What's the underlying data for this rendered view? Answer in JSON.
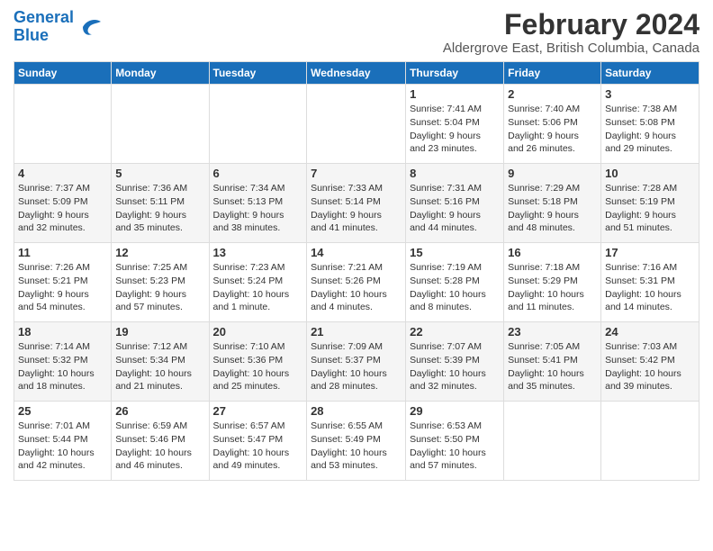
{
  "header": {
    "title": "February 2024",
    "location": "Aldergrove East, British Columbia, Canada",
    "logo_line1": "General",
    "logo_line2": "Blue"
  },
  "days_of_week": [
    "Sunday",
    "Monday",
    "Tuesday",
    "Wednesday",
    "Thursday",
    "Friday",
    "Saturday"
  ],
  "weeks": [
    [
      {
        "day": "",
        "info": ""
      },
      {
        "day": "",
        "info": ""
      },
      {
        "day": "",
        "info": ""
      },
      {
        "day": "",
        "info": ""
      },
      {
        "day": "1",
        "info": "Sunrise: 7:41 AM\nSunset: 5:04 PM\nDaylight: 9 hours\nand 23 minutes."
      },
      {
        "day": "2",
        "info": "Sunrise: 7:40 AM\nSunset: 5:06 PM\nDaylight: 9 hours\nand 26 minutes."
      },
      {
        "day": "3",
        "info": "Sunrise: 7:38 AM\nSunset: 5:08 PM\nDaylight: 9 hours\nand 29 minutes."
      }
    ],
    [
      {
        "day": "4",
        "info": "Sunrise: 7:37 AM\nSunset: 5:09 PM\nDaylight: 9 hours\nand 32 minutes."
      },
      {
        "day": "5",
        "info": "Sunrise: 7:36 AM\nSunset: 5:11 PM\nDaylight: 9 hours\nand 35 minutes."
      },
      {
        "day": "6",
        "info": "Sunrise: 7:34 AM\nSunset: 5:13 PM\nDaylight: 9 hours\nand 38 minutes."
      },
      {
        "day": "7",
        "info": "Sunrise: 7:33 AM\nSunset: 5:14 PM\nDaylight: 9 hours\nand 41 minutes."
      },
      {
        "day": "8",
        "info": "Sunrise: 7:31 AM\nSunset: 5:16 PM\nDaylight: 9 hours\nand 44 minutes."
      },
      {
        "day": "9",
        "info": "Sunrise: 7:29 AM\nSunset: 5:18 PM\nDaylight: 9 hours\nand 48 minutes."
      },
      {
        "day": "10",
        "info": "Sunrise: 7:28 AM\nSunset: 5:19 PM\nDaylight: 9 hours\nand 51 minutes."
      }
    ],
    [
      {
        "day": "11",
        "info": "Sunrise: 7:26 AM\nSunset: 5:21 PM\nDaylight: 9 hours\nand 54 minutes."
      },
      {
        "day": "12",
        "info": "Sunrise: 7:25 AM\nSunset: 5:23 PM\nDaylight: 9 hours\nand 57 minutes."
      },
      {
        "day": "13",
        "info": "Sunrise: 7:23 AM\nSunset: 5:24 PM\nDaylight: 10 hours\nand 1 minute."
      },
      {
        "day": "14",
        "info": "Sunrise: 7:21 AM\nSunset: 5:26 PM\nDaylight: 10 hours\nand 4 minutes."
      },
      {
        "day": "15",
        "info": "Sunrise: 7:19 AM\nSunset: 5:28 PM\nDaylight: 10 hours\nand 8 minutes."
      },
      {
        "day": "16",
        "info": "Sunrise: 7:18 AM\nSunset: 5:29 PM\nDaylight: 10 hours\nand 11 minutes."
      },
      {
        "day": "17",
        "info": "Sunrise: 7:16 AM\nSunset: 5:31 PM\nDaylight: 10 hours\nand 14 minutes."
      }
    ],
    [
      {
        "day": "18",
        "info": "Sunrise: 7:14 AM\nSunset: 5:32 PM\nDaylight: 10 hours\nand 18 minutes."
      },
      {
        "day": "19",
        "info": "Sunrise: 7:12 AM\nSunset: 5:34 PM\nDaylight: 10 hours\nand 21 minutes."
      },
      {
        "day": "20",
        "info": "Sunrise: 7:10 AM\nSunset: 5:36 PM\nDaylight: 10 hours\nand 25 minutes."
      },
      {
        "day": "21",
        "info": "Sunrise: 7:09 AM\nSunset: 5:37 PM\nDaylight: 10 hours\nand 28 minutes."
      },
      {
        "day": "22",
        "info": "Sunrise: 7:07 AM\nSunset: 5:39 PM\nDaylight: 10 hours\nand 32 minutes."
      },
      {
        "day": "23",
        "info": "Sunrise: 7:05 AM\nSunset: 5:41 PM\nDaylight: 10 hours\nand 35 minutes."
      },
      {
        "day": "24",
        "info": "Sunrise: 7:03 AM\nSunset: 5:42 PM\nDaylight: 10 hours\nand 39 minutes."
      }
    ],
    [
      {
        "day": "25",
        "info": "Sunrise: 7:01 AM\nSunset: 5:44 PM\nDaylight: 10 hours\nand 42 minutes."
      },
      {
        "day": "26",
        "info": "Sunrise: 6:59 AM\nSunset: 5:46 PM\nDaylight: 10 hours\nand 46 minutes."
      },
      {
        "day": "27",
        "info": "Sunrise: 6:57 AM\nSunset: 5:47 PM\nDaylight: 10 hours\nand 49 minutes."
      },
      {
        "day": "28",
        "info": "Sunrise: 6:55 AM\nSunset: 5:49 PM\nDaylight: 10 hours\nand 53 minutes."
      },
      {
        "day": "29",
        "info": "Sunrise: 6:53 AM\nSunset: 5:50 PM\nDaylight: 10 hours\nand 57 minutes."
      },
      {
        "day": "",
        "info": ""
      },
      {
        "day": "",
        "info": ""
      }
    ]
  ]
}
